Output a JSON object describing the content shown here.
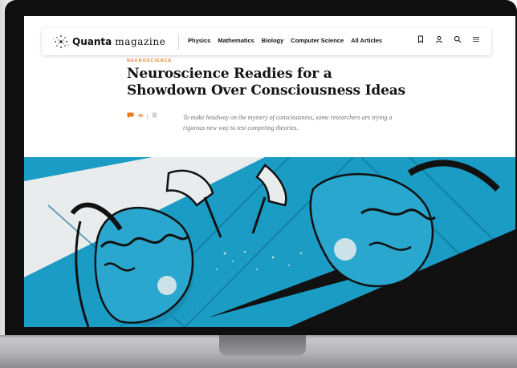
{
  "nav": {
    "logo_quanta": "Quanta",
    "logo_magazine": "magazine",
    "links": [
      "Physics",
      "Mathematics",
      "Biology",
      "Computer Science",
      "All Articles"
    ],
    "icons": [
      "bookmark-icon",
      "user-icon",
      "search-icon",
      "menu-icon"
    ]
  },
  "article": {
    "section": "NEUROSCIENCE",
    "headline": "Neuroscience Readies for a Showdown Over Consciousness Ideas",
    "comment_count": "46",
    "dek": "To make headway on the mystery of consciousness, some researchers are trying a rigorous new way to test competing theories."
  },
  "colors": {
    "accent": "#e87b20",
    "hero_blue": "#1b9cc4",
    "laptop_frame": "#0f0f10"
  }
}
